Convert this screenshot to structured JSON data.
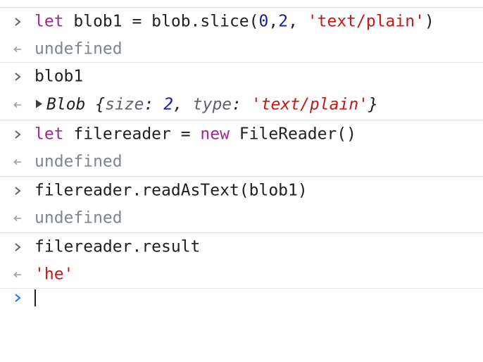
{
  "console": {
    "entries": [
      {
        "kind": "input",
        "tokens": {
          "kw": "let",
          "mid1": " blob1 = blob.slice(",
          "n0": "0",
          "comma": ",",
          "n2": "2",
          "mid2": ", ",
          "str": "'text/plain'",
          "end": ")"
        }
      },
      {
        "kind": "output",
        "text": "undefined"
      },
      {
        "kind": "input",
        "text": "blob1"
      },
      {
        "kind": "output-object",
        "tokens": {
          "type": "Blob",
          "open": " {",
          "k1": "size",
          "colon1": ": ",
          "v1": "2",
          "sep": ", ",
          "k2": "type",
          "colon2": ": ",
          "v2": "'text/plain'",
          "close": "}"
        }
      },
      {
        "kind": "input",
        "tokens": {
          "kw1": "let",
          "mid": " filereader = ",
          "kw2": "new",
          "end": " FileReader()"
        }
      },
      {
        "kind": "output",
        "text": "undefined"
      },
      {
        "kind": "input",
        "text": "filereader.readAsText(blob1)"
      },
      {
        "kind": "output",
        "text": "undefined"
      },
      {
        "kind": "input",
        "text": "filereader.result"
      },
      {
        "kind": "output-string",
        "text": "'he'"
      }
    ],
    "prompt_value": ""
  },
  "icons": {
    "input_arrow": "chevron-right-icon",
    "output_arrow": "return-arrow-icon",
    "expand": "disclosure-triangle-icon",
    "prompt": "prompt-chevron-icon"
  },
  "colors": {
    "keyword": "#9c2a8e",
    "string": "#c41a16",
    "number": "#1a1aa6",
    "undefined": "#80868b",
    "prompt_chevron": "#1a73e8",
    "divider": "#e3e3e3"
  }
}
